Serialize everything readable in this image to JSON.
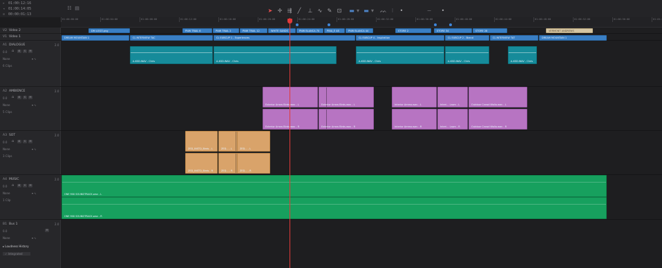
{
  "timecodes": [
    {
      "marker": "▸",
      "value": "01:00:12:16"
    },
    {
      "marker": "◂",
      "value": "01:00:14:05"
    },
    {
      "marker": "⊙",
      "value": "00:00:01:13"
    }
  ],
  "toolbar": {
    "tools": [
      "select-tool",
      "trim-tool",
      "dynamic-trim-tool",
      "blade-tool",
      "insert-tool",
      "link-tool",
      "flag-tool",
      "snap-tool",
      "marker-tool",
      "marker-dropdown",
      "flag-tool-2",
      "flag-dropdown",
      "audio-tool",
      "audio-dropdown",
      "zoom-out-tool",
      "zoom-in-tool"
    ]
  },
  "ruler": {
    "ticks": [
      "01:00:00:00",
      "01:00:04:00",
      "01:00:08:00",
      "01:00:12:00",
      "01:00:16:00",
      "01:00:20:00",
      "01:00:24:00",
      "01:00:28:00",
      "01:00:32:00",
      "01:00:36:00",
      "01:00:40:00",
      "01:00:44:00",
      "01:00:48:00",
      "01:00:52:00",
      "01:00:56:00",
      "01:01:00:00"
    ]
  },
  "tracks": {
    "v2": {
      "id": "V2",
      "name": "Video 2"
    },
    "v1": {
      "id": "V1",
      "name": "Video 1"
    },
    "a1": {
      "id": "A1",
      "name": "DIALOGUE",
      "level": "2.0",
      "volume": "0.0",
      "effect": "None",
      "clips": "6 Clips"
    },
    "a2": {
      "id": "A2",
      "name": "AMBIENCE",
      "level": "2.0",
      "volume": "0.0",
      "effect": "None",
      "clips": "5 Clips"
    },
    "a3": {
      "id": "A3",
      "name": "SOT",
      "level": "2.0",
      "volume": "0.0",
      "effect": "None",
      "clips": "3 Clips"
    },
    "a4": {
      "id": "A4",
      "name": "MUSIC",
      "level": "2.0",
      "volume": "0.0",
      "effect": "None",
      "clips": "1 Clip"
    },
    "b1": {
      "id": "B1",
      "name": "Bus 1",
      "level": "2.0",
      "volume": "0.0",
      "effect": "None"
    }
  },
  "loudness": {
    "title": "Loudness History",
    "item": "Integrated"
  },
  "clips": {
    "v2": [
      "DM LOGO.png",
      "PNW TRAIL 6",
      "PNW TRAIL 2",
      "PNW TRAIL 12",
      "WHITE SANDS",
      "PNW BLANCA 70",
      "PINA_E 48",
      "PNW BLANCA 44",
      "STORE 2",
      "STORE 34",
      "STORE 28",
      "VERMONT ANDREWS"
    ],
    "v1": [
      "DREAM MOUNTAIN 1",
      "CL INTERVIEW TAC",
      "CL EUBCUP 1 - Experiences",
      "CL EUBCUP 4 - Inspiration",
      "CL EUBCUP 2 - Brand",
      "CL INTERVIEW TAT",
      "DREAM MOUNTAIN 1"
    ],
    "a1": [
      "A-KSD.WAV - Chris",
      "A-KSD.WAV - Chris",
      "A-KSD.WAV - Chris",
      "A-KSD.WAV - Chris",
      "A-KSD.WAV - Chris"
    ],
    "a2_top": [
      "Exterior Arrow Birds.wav - L",
      "Exterior Arrow Birds.wav - L",
      "Interior Ammo.wav - L",
      "Interi... Lawn - L",
      "Outdoor Crowd Walla.wav - L"
    ],
    "a2_bot": [
      "Exterior Arrow Birds.wav - R",
      "Exterior Arrow Birds.wav - R",
      "Interior Ammo.wav - R",
      "Interi... Lawn - R",
      "Outdoor Crowd Walla.wav - R"
    ],
    "a3_top": [
      "ZED_INSTD_Birds - L",
      "ZED... - L",
      "ZED... - L"
    ],
    "a3_bot": [
      "ZED_INSTD_Birds - R",
      "ZED... - R",
      "ZED... - R"
    ],
    "a4": [
      "ONE MIX SOUNDTRACK.wav - L",
      "ONE MIX SOUNDTRACK.wav - R"
    ]
  },
  "colors": {
    "video": "#3a7fc4",
    "dialogue": "#168b9a",
    "ambience": "#b774c2",
    "sot": "#d9a36a",
    "music": "#17a05e",
    "playhead": "#e23a3a"
  }
}
